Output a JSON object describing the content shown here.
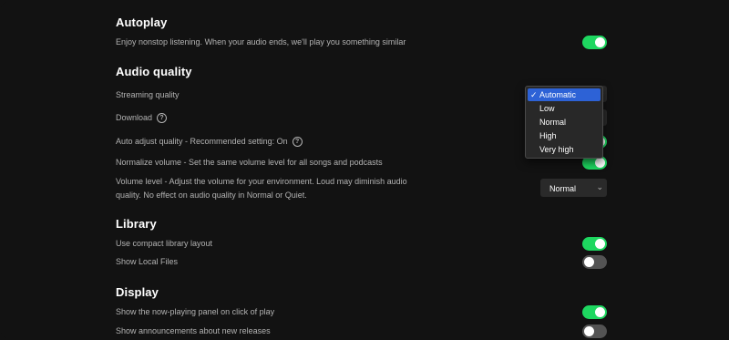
{
  "sections": {
    "autoplay": {
      "title": "Autoplay",
      "rows": [
        {
          "label": "Enjoy nonstop listening. When your audio ends, we'll play you something similar",
          "toggle": "on"
        }
      ]
    },
    "audio_quality": {
      "title": "Audio quality",
      "streaming_label": "Streaming quality",
      "download_label": "Download",
      "auto_adjust_label": "Auto adjust quality - Recommended setting: On",
      "normalize_label": "Normalize volume - Set the same volume level for all songs and podcasts",
      "volume_level_label": "Volume level - Adjust the volume for your environment. Loud may diminish audio quality. No effect on audio quality in Normal or Quiet.",
      "volume_level_value": "Normal",
      "help_glyph": "?"
    },
    "library": {
      "title": "Library",
      "compact_label": "Use compact library layout",
      "local_files_label": "Show Local Files"
    },
    "display": {
      "title": "Display",
      "now_playing_label": "Show the now-playing panel on click of play",
      "announcements_label": "Show announcements about new releases"
    }
  },
  "streaming_dropdown": {
    "selected": "Automatic",
    "check_glyph": "✓",
    "options": [
      "Automatic",
      "Low",
      "Normal",
      "High",
      "Very high"
    ]
  },
  "toggles": {
    "autoplay": "on",
    "auto_adjust": "on",
    "normalize": "on",
    "compact_library": "on",
    "local_files": "off",
    "now_playing_panel": "on",
    "announcements": "off"
  },
  "icons": {
    "help": "help-circle-icon",
    "chevron": "chevron-down-icon",
    "check": "checkmark-icon"
  },
  "colors": {
    "background": "#121212",
    "toggle_on": "#1ed760",
    "toggle_off": "#535353",
    "dropdown_highlight": "#2d62d6",
    "secondary_text": "#b3b3b3"
  }
}
